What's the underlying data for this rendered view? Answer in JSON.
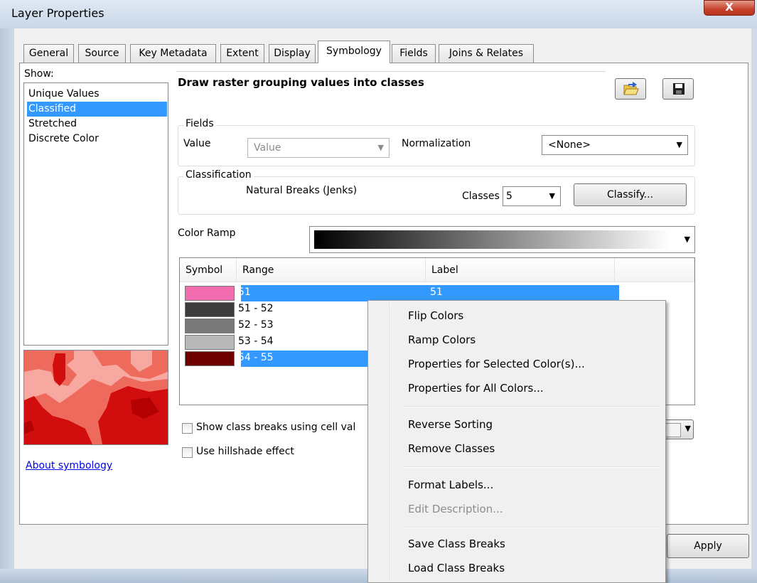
{
  "window": {
    "title": "Layer Properties",
    "close_glyph": "X"
  },
  "tabs": [
    {
      "label": "General"
    },
    {
      "label": "Source"
    },
    {
      "label": "Key Metadata"
    },
    {
      "label": "Extent"
    },
    {
      "label": "Display"
    },
    {
      "label": "Symbology"
    },
    {
      "label": "Fields"
    },
    {
      "label": "Joins & Relates"
    }
  ],
  "active_tab": "Symbology",
  "show": {
    "label": "Show:",
    "items": [
      {
        "label": "Unique Values"
      },
      {
        "label": "Classified"
      },
      {
        "label": "Stretched"
      },
      {
        "label": "Discrete Color"
      }
    ],
    "selected": "Classified"
  },
  "about_link": "About symbology",
  "heading": "Draw raster grouping values into classes",
  "fields": {
    "group_label": "Fields",
    "value_label": "Value",
    "value_selected": "Value",
    "normalization_label": "Normalization",
    "normalization_selected": "<None>"
  },
  "classification": {
    "group_label": "Classification",
    "method": "Natural Breaks (Jenks)",
    "classes_label": "Classes",
    "classes_selected": "5",
    "classify_button": "Classify..."
  },
  "color_ramp": {
    "label": "Color Ramp",
    "from": "#000000",
    "to": "#ffffff"
  },
  "class_table": {
    "headers": [
      "Symbol",
      "Range",
      "Label"
    ],
    "rows": [
      {
        "color": "#f26cb0",
        "range": "51",
        "label": "51",
        "selected": true
      },
      {
        "color": "#3c3c3c",
        "range": "51 - 52",
        "label": "",
        "selected": false
      },
      {
        "color": "#787878",
        "range": "52 - 53",
        "label": "",
        "selected": false
      },
      {
        "color": "#b8b8b8",
        "range": "53 - 54",
        "label": "",
        "selected": false
      },
      {
        "color": "#6e0000",
        "range": "54 - 55",
        "label": "",
        "selected": true
      }
    ]
  },
  "options": {
    "show_class_breaks": "Show class breaks using cell val",
    "hillshade": "Use hillshade effect"
  },
  "buttons": {
    "apply": "Apply"
  },
  "context_menu": {
    "groups": [
      [
        {
          "label": "Flip Colors",
          "enabled": true
        },
        {
          "label": "Ramp Colors",
          "enabled": true
        },
        {
          "label": "Properties for Selected Color(s)...",
          "enabled": true
        },
        {
          "label": "Properties for All Colors...",
          "enabled": true
        }
      ],
      [
        {
          "label": "Reverse Sorting",
          "enabled": true
        },
        {
          "label": "Remove Classes",
          "enabled": true
        }
      ],
      [
        {
          "label": "Format Labels...",
          "enabled": true
        },
        {
          "label": "Edit Description...",
          "enabled": false
        }
      ],
      [
        {
          "label": "Save Class Breaks",
          "enabled": true
        },
        {
          "label": "Load Class Breaks",
          "enabled": true
        }
      ]
    ]
  },
  "colors": {
    "selection": "#3399ff",
    "link": "#0000ee"
  }
}
